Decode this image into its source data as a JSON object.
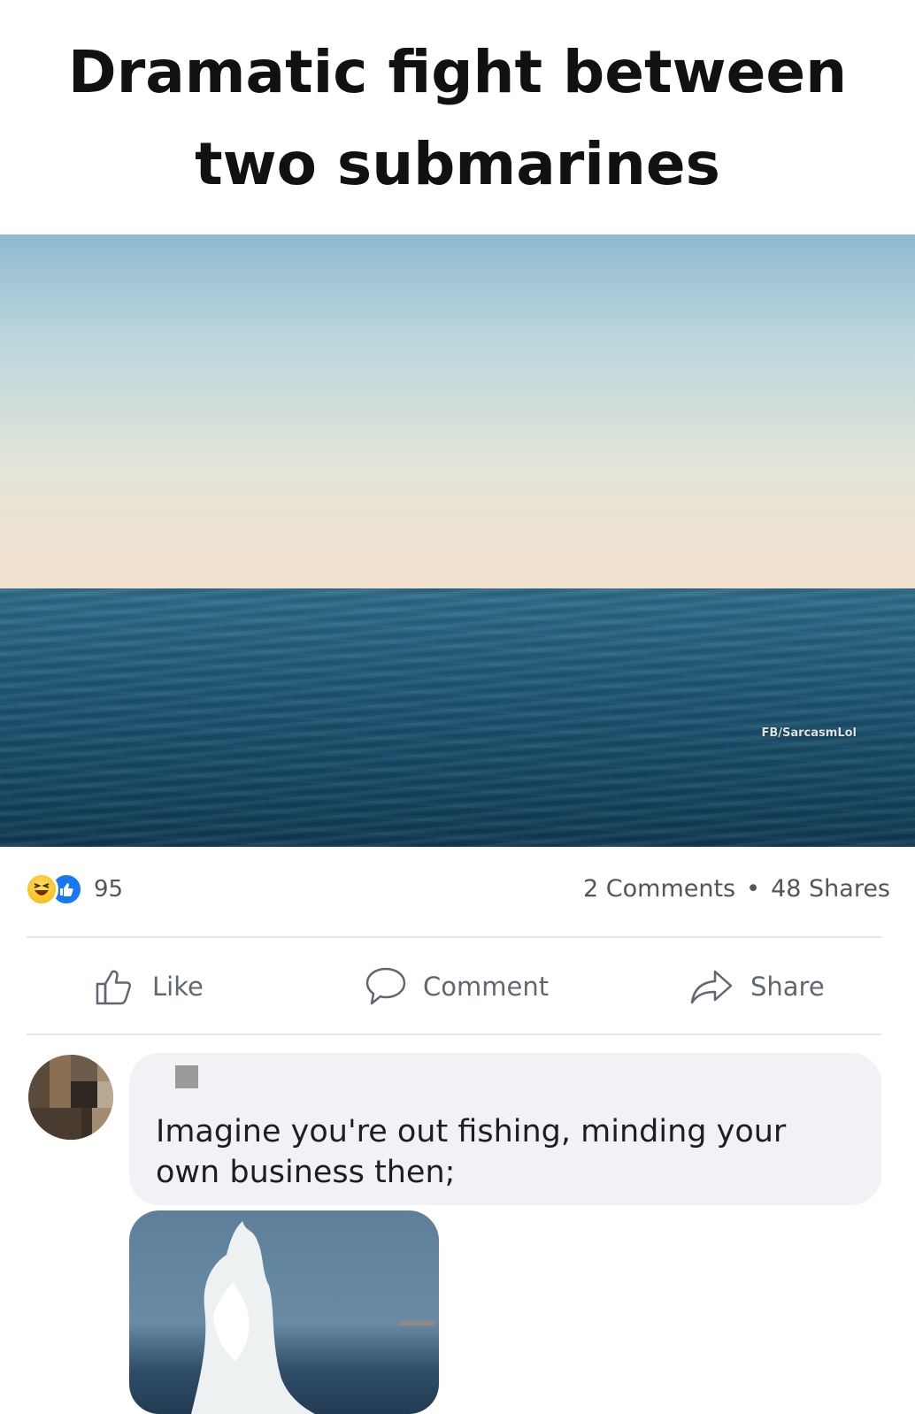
{
  "post": {
    "title_line1": "Dramatic fight between",
    "title_line2": "two submarines",
    "image_watermark": "FB/SarcasmLol"
  },
  "stats": {
    "reaction_count": "95",
    "comments": "2 Comments",
    "separator": "•",
    "shares": "48 Shares"
  },
  "actions": {
    "like": "Like",
    "comment": "Comment",
    "share": "Share"
  },
  "comment": {
    "text": "Imagine you're out fishing, minding your own business then;"
  },
  "colors": {
    "like_blue": "#1877f2",
    "text_gray": "#606770",
    "bubble_bg": "#f0f2f5"
  }
}
